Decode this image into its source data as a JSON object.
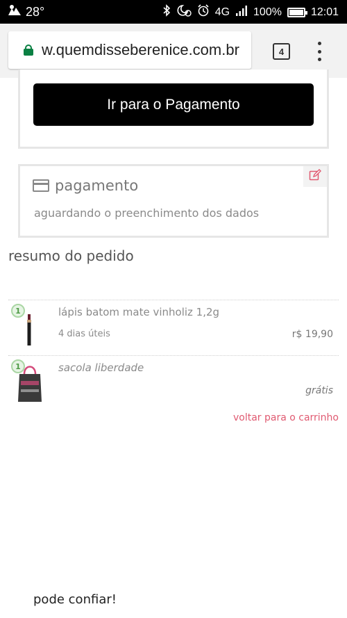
{
  "status_bar": {
    "temperature": "28°",
    "network": "4G",
    "battery": "100%",
    "time": "12:01"
  },
  "browser": {
    "url": "w.quemdisseberenice.com.br",
    "tab_count": "4"
  },
  "checkout": {
    "pay_button_label": "Ir para o Pagamento"
  },
  "payment": {
    "title": "pagamento",
    "subtitle": "aguardando o preenchimento dos dados"
  },
  "summary": {
    "title": "resumo do pedido",
    "items": [
      {
        "qty": "1",
        "name": "lápis batom mate vinholiz 1,2g",
        "delivery": "4 dias úteis",
        "price": "r$ 19,90"
      },
      {
        "qty": "1",
        "name": "sacola liberdade",
        "delivery": "",
        "price": "grátis"
      }
    ],
    "back_link": "voltar para o carrinho"
  },
  "footer": {
    "text": "pode confiar!"
  },
  "colors": {
    "accent_pink": "#e05a71",
    "qty_green": "#4e9a45",
    "secure_green": "#0b8043"
  }
}
